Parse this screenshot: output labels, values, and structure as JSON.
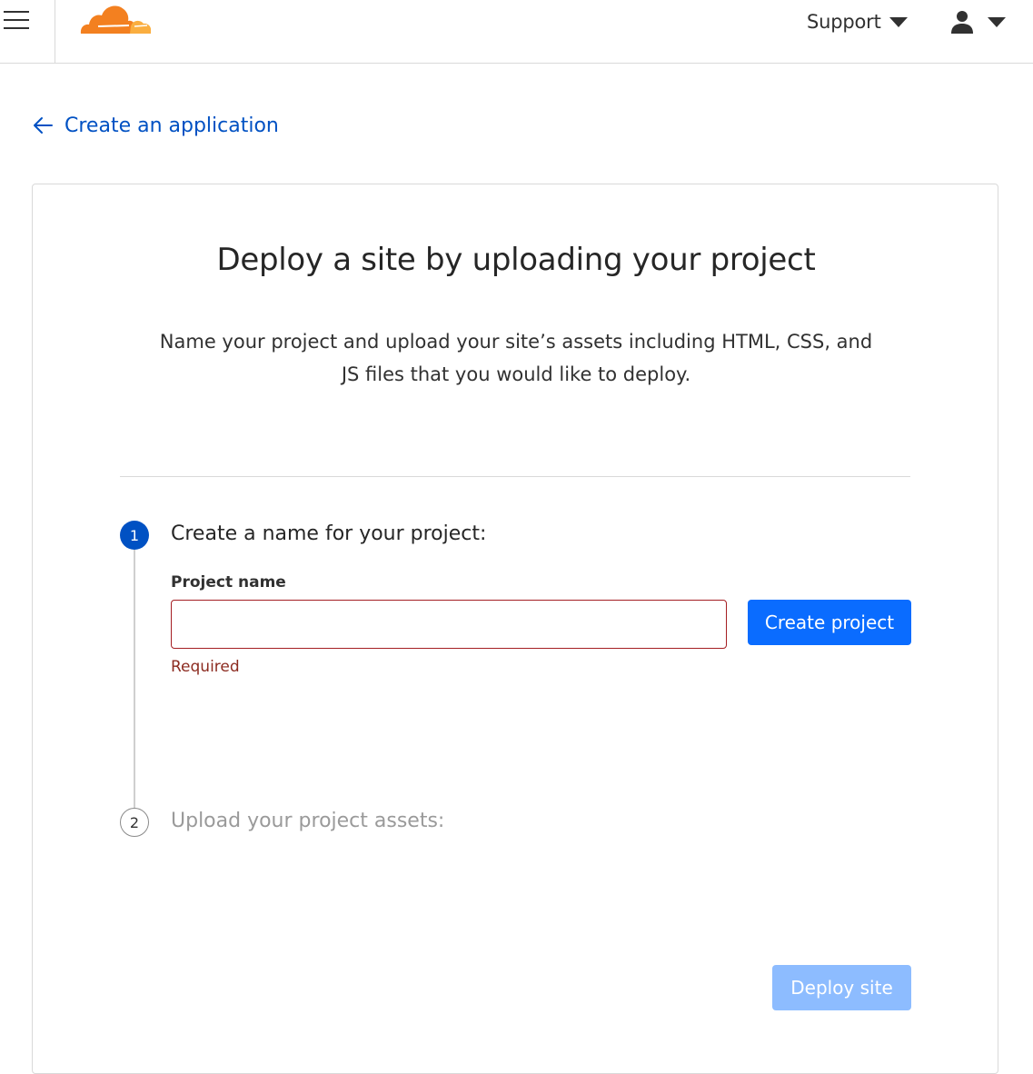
{
  "topbar": {
    "menu_icon": "hamburger-menu-icon",
    "logo_icon": "cloudflare-cloud-logo",
    "support_label": "Support",
    "user_icon": "user-account-icon",
    "caret_icon": "caret-down-icon"
  },
  "back_link": {
    "icon": "arrow-left-icon",
    "label": "Create an application"
  },
  "card": {
    "title": "Deploy a site by uploading your project",
    "description": "Name your project and upload your site’s assets including HTML, CSS, and JS files that you would like to deploy."
  },
  "steps": [
    {
      "number": "1",
      "title": "Create a name for your project:",
      "state": "active"
    },
    {
      "number": "2",
      "title": "Upload your project assets:",
      "state": "inactive"
    }
  ],
  "form": {
    "field_label": "Project name",
    "input_value": "",
    "input_placeholder": "",
    "error_text": "Required",
    "create_button_label": "Create project",
    "deploy_button_label": "Deploy site"
  },
  "colors": {
    "brand_orange": "#f38020",
    "brand_light_orange": "#faae40",
    "link_blue": "#0051c3",
    "primary_button": "#0a6cff",
    "disabled_button": "#8dbcff",
    "error_red": "#a41e22"
  }
}
